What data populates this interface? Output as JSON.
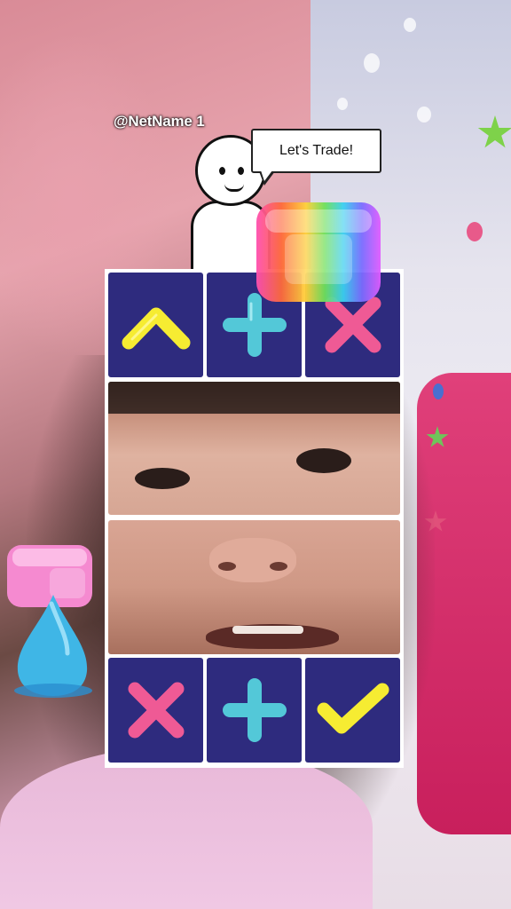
{
  "header": {
    "username": "@NetName 1"
  },
  "bubble": {
    "text": "Let's Trade!"
  },
  "top_buttons": [
    {
      "label": "caret-up",
      "color": "#f6ec32"
    },
    {
      "label": "plus",
      "color": "#53c8d8"
    },
    {
      "label": "x",
      "color": "#ef5a95"
    }
  ],
  "bottom_buttons": [
    {
      "label": "x",
      "color": "#ef5a95"
    },
    {
      "label": "plus",
      "color": "#53c8d8"
    },
    {
      "label": "check",
      "color": "#f6ec32"
    }
  ],
  "colors": {
    "tile": "#2e2b7e",
    "panel": "#ffffff"
  },
  "icons": [
    "caret-up-icon",
    "plus-icon",
    "close-icon",
    "check-icon",
    "rainbow-cube-sticker",
    "pink-cube-sticker",
    "blue-drop-sticker"
  ]
}
